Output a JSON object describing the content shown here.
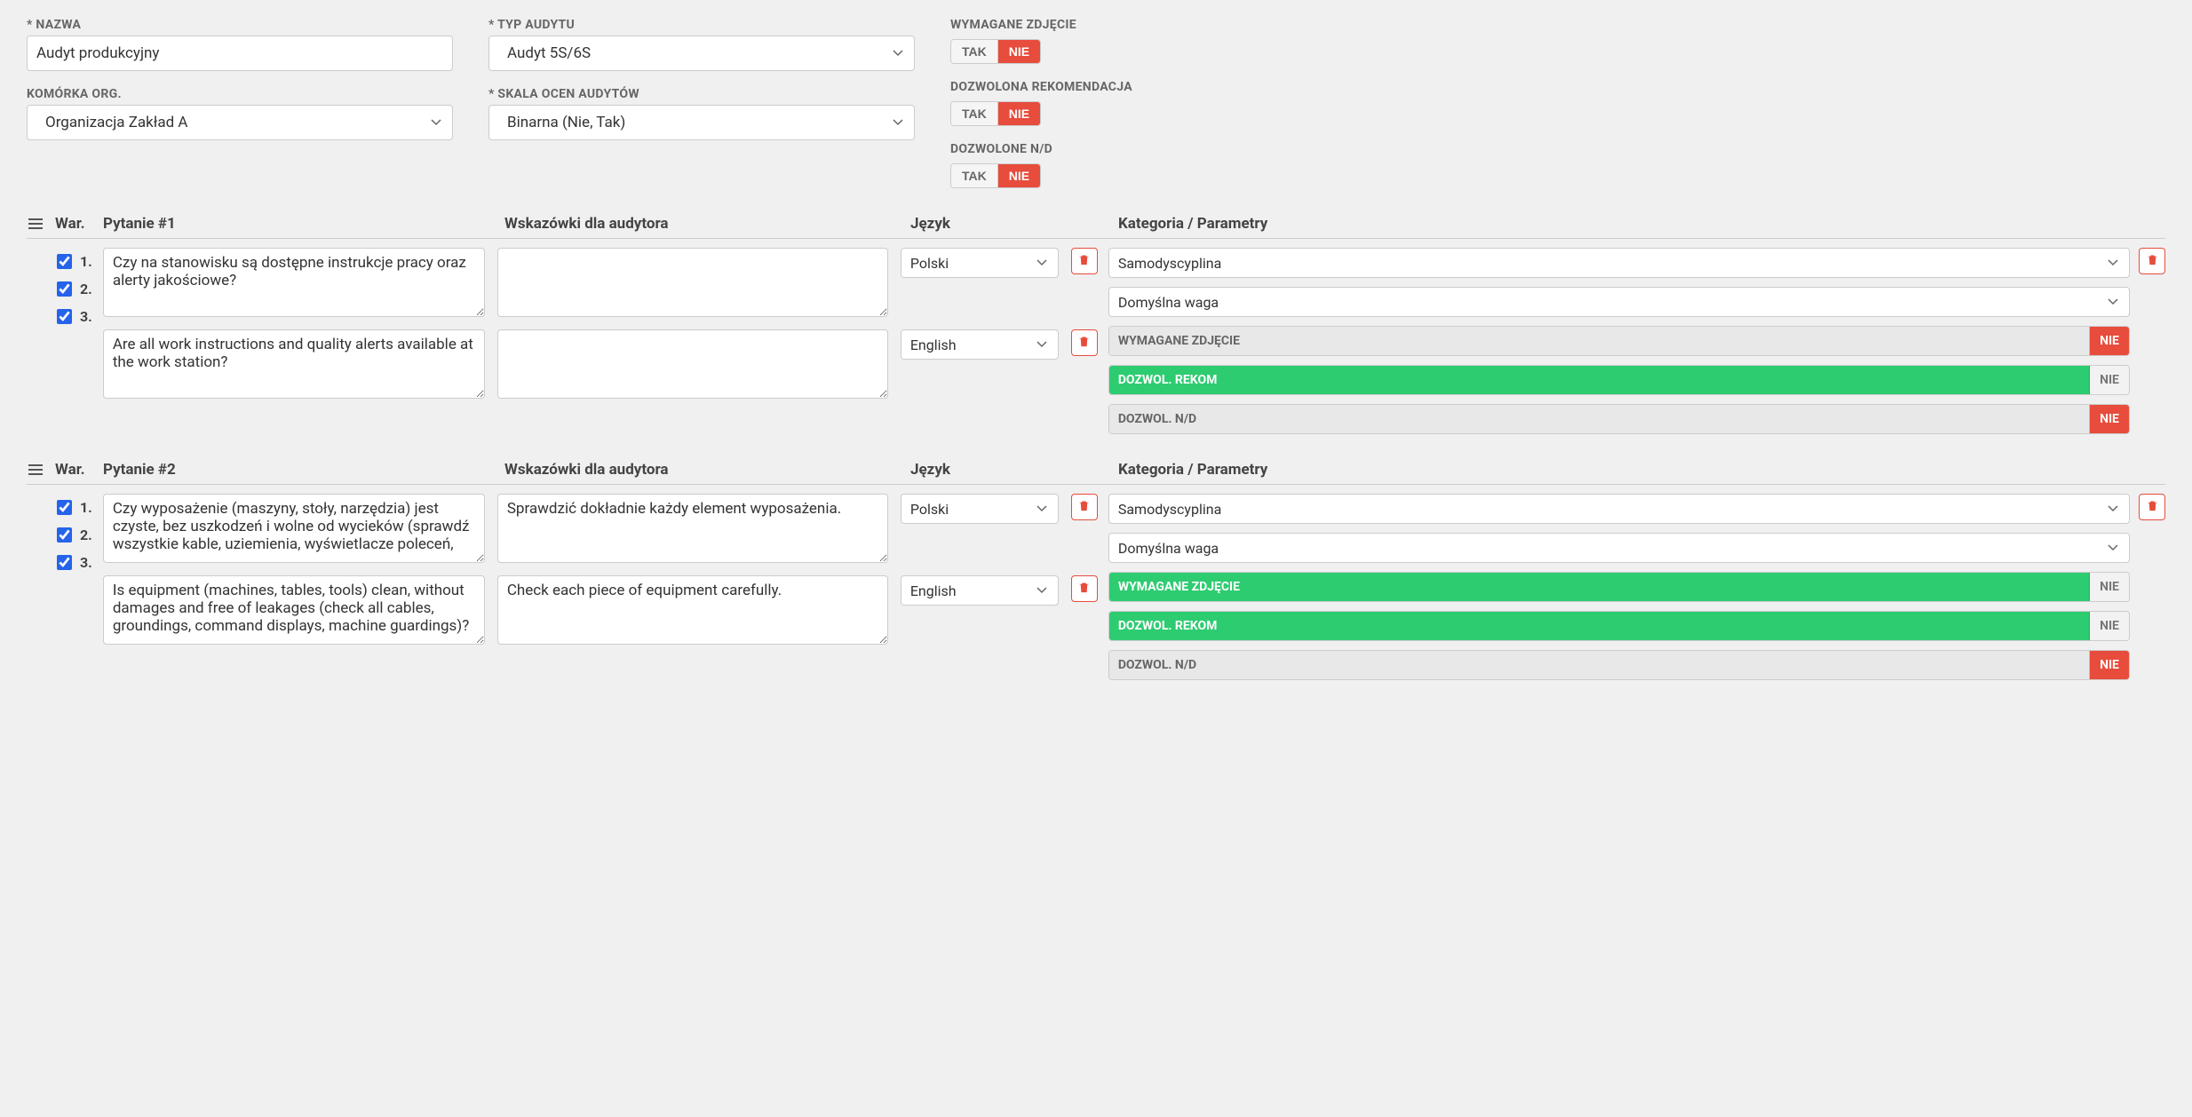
{
  "labels": {
    "name": "* NAZWA",
    "auditType": "* TYP AUDYTU",
    "orgUnit": "KOMÓRKA ORG.",
    "ratingScale": "* SKALA OCEN AUDYTÓW",
    "photoRequired": "WYMAGANE ZDJĘCIE",
    "recomAllowed": "DOZWOLONA REKOMENDACJA",
    "ndAllowed": "DOZWOLONE N/D",
    "yes": "TAK",
    "no": "NIE",
    "warShort": "War.",
    "hints": "Wskazówki dla audytora",
    "language": "Język",
    "catParams": "Kategoria / Parametry",
    "paramPhoto": "WYMAGANE ZDJĘCIE",
    "paramRecom": "DOZWOL. REKOM",
    "paramNd": "DOZWOL. N/D"
  },
  "form": {
    "name": "Audyt produkcyjny",
    "auditType": "Audyt 5S/6S",
    "orgUnit": "Organizacja Zakład A",
    "ratingScale": "Binarna (Nie, Tak)"
  },
  "questions": [
    {
      "title": "Pytanie #1",
      "checks": [
        "1.",
        "2.",
        "3."
      ],
      "translations": [
        {
          "text": "Czy na stanowisku są dostępne instrukcje pracy oraz alerty jakościowe?",
          "hint": "",
          "language": "Polski"
        },
        {
          "text": "Are all work instructions and quality alerts available at the work station?",
          "hint": "",
          "language": "English"
        }
      ],
      "category": "Samodyscyplina",
      "weight": "Domyślna waga",
      "paramPhotoActive": false,
      "paramRecomActive": true,
      "paramNdActive": false
    },
    {
      "title": "Pytanie #2",
      "checks": [
        "1.",
        "2.",
        "3."
      ],
      "translations": [
        {
          "text": "Czy wyposażenie (maszyny, stoły, narzędzia) jest czyste, bez uszkodzeń i wolne od wycieków (sprawdź wszystkie kable, uziemienia, wyświetlacze poleceń,",
          "hint": "Sprawdzić dokładnie każdy element wyposażenia.",
          "language": "Polski"
        },
        {
          "text": "Is equipment (machines, tables, tools) clean, without damages and free of leakages (check all cables, groundings, command displays, machine guardings)?",
          "hint": "Check each piece of equipment carefully.",
          "language": "English"
        }
      ],
      "category": "Samodyscyplina",
      "weight": "Domyślna waga",
      "paramPhotoActive": true,
      "paramRecomActive": true,
      "paramNdActive": false
    }
  ]
}
